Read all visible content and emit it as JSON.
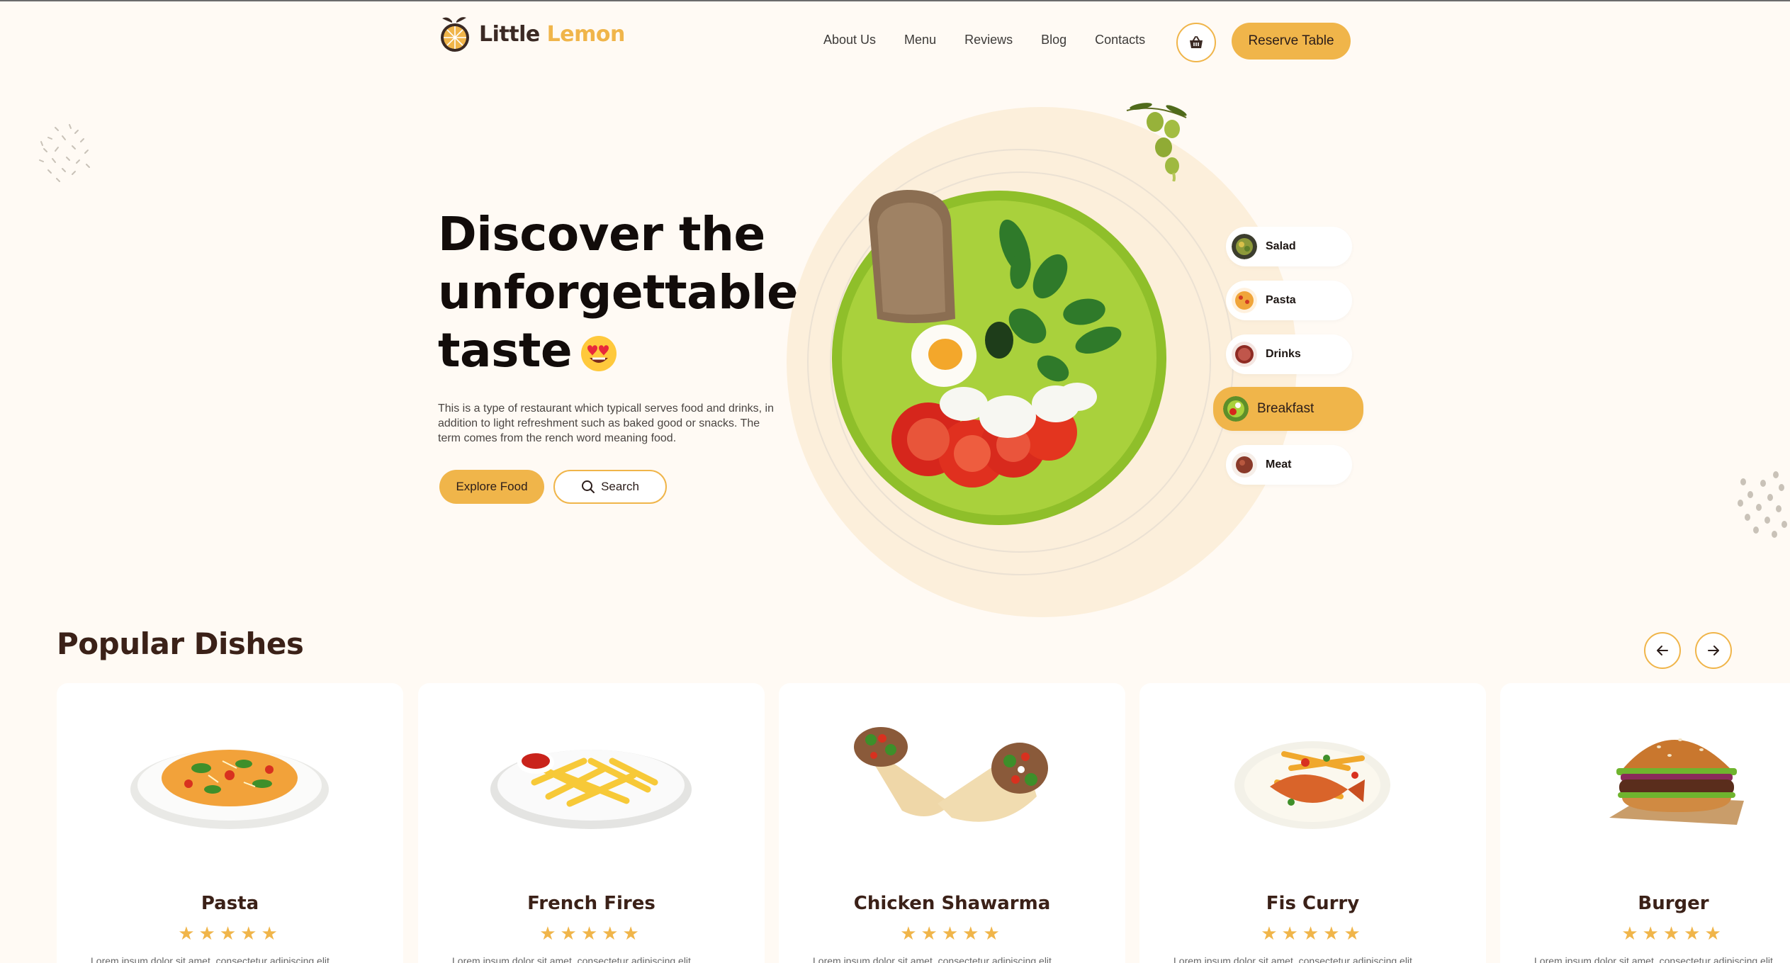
{
  "brand": {
    "name_part1": "Little",
    "name_part2": "Lemon"
  },
  "nav": {
    "items": [
      "About Us",
      "Menu",
      "Reviews",
      "Blog",
      "Contacts"
    ]
  },
  "header": {
    "cart_icon": "basket-icon",
    "reserve_label": "Reserve Table"
  },
  "hero": {
    "title_line1": "Discover the",
    "title_line2": "unforgettable",
    "title_line3": "taste",
    "emoji": "heart-eyes-emoji",
    "description": "This is a type of restaurant which typicall serves food and drinks, in addition to light refreshment such as baked good or snacks. The term comes from the rench word meaning food.",
    "explore_label": "Explore Food",
    "search_label": "Search"
  },
  "categories": [
    {
      "label": "Salad",
      "active": false
    },
    {
      "label": "Pasta",
      "active": false
    },
    {
      "label": "Drinks",
      "active": false
    },
    {
      "label": "Breakfast",
      "active": true
    },
    {
      "label": "Meat",
      "active": false
    }
  ],
  "popular": {
    "title": "Popular Dishes",
    "prev_icon": "arrow-left-icon",
    "next_icon": "arrow-right-icon",
    "dishes": [
      {
        "name": "Pasta",
        "rating": 5,
        "desc": "Lorem ipsum dolor sit amet, consectetur adipiscing elit"
      },
      {
        "name": "French Fires",
        "rating": 5,
        "desc": "Lorem ipsum dolor sit amet, consectetur adipiscing elit"
      },
      {
        "name": "Chicken Shawarma",
        "rating": 5,
        "desc": "Lorem ipsum dolor sit amet, consectetur adipiscing elit"
      },
      {
        "name": "Fis Curry",
        "rating": 5,
        "desc": "Lorem ipsum dolor sit amet, consectetur adipiscing elit"
      },
      {
        "name": "Burger",
        "rating": 5,
        "desc": "Lorem ipsum dolor sit amet, consectetur adipiscing elit"
      }
    ]
  },
  "colors": {
    "accent": "#f0b54a",
    "background": "#fffaf4",
    "heading": "#3b2118"
  }
}
